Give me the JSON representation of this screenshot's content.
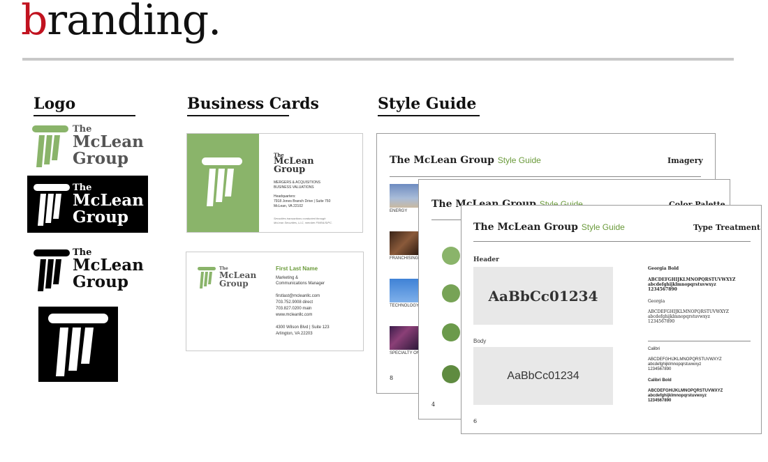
{
  "title": {
    "first_letter": "b",
    "rest": "randing."
  },
  "sections": {
    "logo": "Logo",
    "business_cards": "Business Cards",
    "style_guide": "Style Guide"
  },
  "brand": {
    "the": "The",
    "mclean": "McLean",
    "group": "Group",
    "green": "#8ab46a",
    "green_dark": "#6a9a3a"
  },
  "card_front": {
    "the": "The",
    "mclean": "McLean",
    "group": "Group",
    "services": [
      "MERGERS & ACQUISITIONS",
      "BUSINESS VALUATIONS"
    ],
    "hq_label": "Headquarters:",
    "hq_address": [
      "7918 Jones Branch Drive | Suite 750",
      "McLean, VA 22102"
    ],
    "disclaimer": [
      "Securities transactions conducted through",
      "McLean Securities, LLC, member FINRA/SIPC."
    ]
  },
  "card_back": {
    "the": "The",
    "mclean": "McLean",
    "group": "Group",
    "name": "First Last Name",
    "title_lines": [
      "Marketing &",
      "Communications Manager"
    ],
    "contact": [
      "firstlast@mcleanllc.com",
      "703.752.9008 direct",
      "703.827.0200 main",
      "www.mcleanllc.com"
    ],
    "address": [
      "4300 Wilson Blvd | Suite 123",
      "Arlington, VA 22203"
    ]
  },
  "style_guide": {
    "brand": "The McLean Group",
    "brand_suffix": "Style Guide",
    "page1": {
      "right": "Imagery",
      "number": "8",
      "labels": [
        "ENERGY",
        "FRANCHISING",
        "TECHNOLOGY",
        "SPECIALTY ON"
      ]
    },
    "page2": {
      "right": "Color Palette",
      "number": "4",
      "swatch_colors": [
        "#8ab46a",
        "#77a356",
        "#6b9a4b",
        "#5f8b40"
      ]
    },
    "page3": {
      "right": "Type Treatment",
      "number": "6",
      "header_label": "Header",
      "header_sample": "AaBbCc01234",
      "body_label": "Body",
      "body_sample": "AaBbCc01234",
      "georgia_bold": {
        "name": "Georgia  Bold",
        "upper": "ABCDEFGHIJKLMNOPQRSTUVWXYZ",
        "lower": "abcdefghijklmnopqrstuvwxyz",
        "digits": "1234567890"
      },
      "georgia": {
        "name": "Georgia",
        "upper": "ABCDEFGHIJKLMNOPQRSTUVWXYZ",
        "lower": "abcdefghijklmnopqrstuvwxyz",
        "digits": "1234567890"
      },
      "calibri": {
        "name": "Calibri",
        "upper": "ABCDEFGHIJKLMNOPQRSTUVWXYZ",
        "lower": "abcdefghijklmnopqrstuvwxyz",
        "digits": "1234567890"
      },
      "calibri_bold": {
        "name": "Calibri Bold",
        "upper": "ABCDEFGHIJKLMNOPQRSTUVWXYZ",
        "lower": "abcdefghijklmnopqrstuvwxyz",
        "digits": "1234567890"
      }
    }
  }
}
